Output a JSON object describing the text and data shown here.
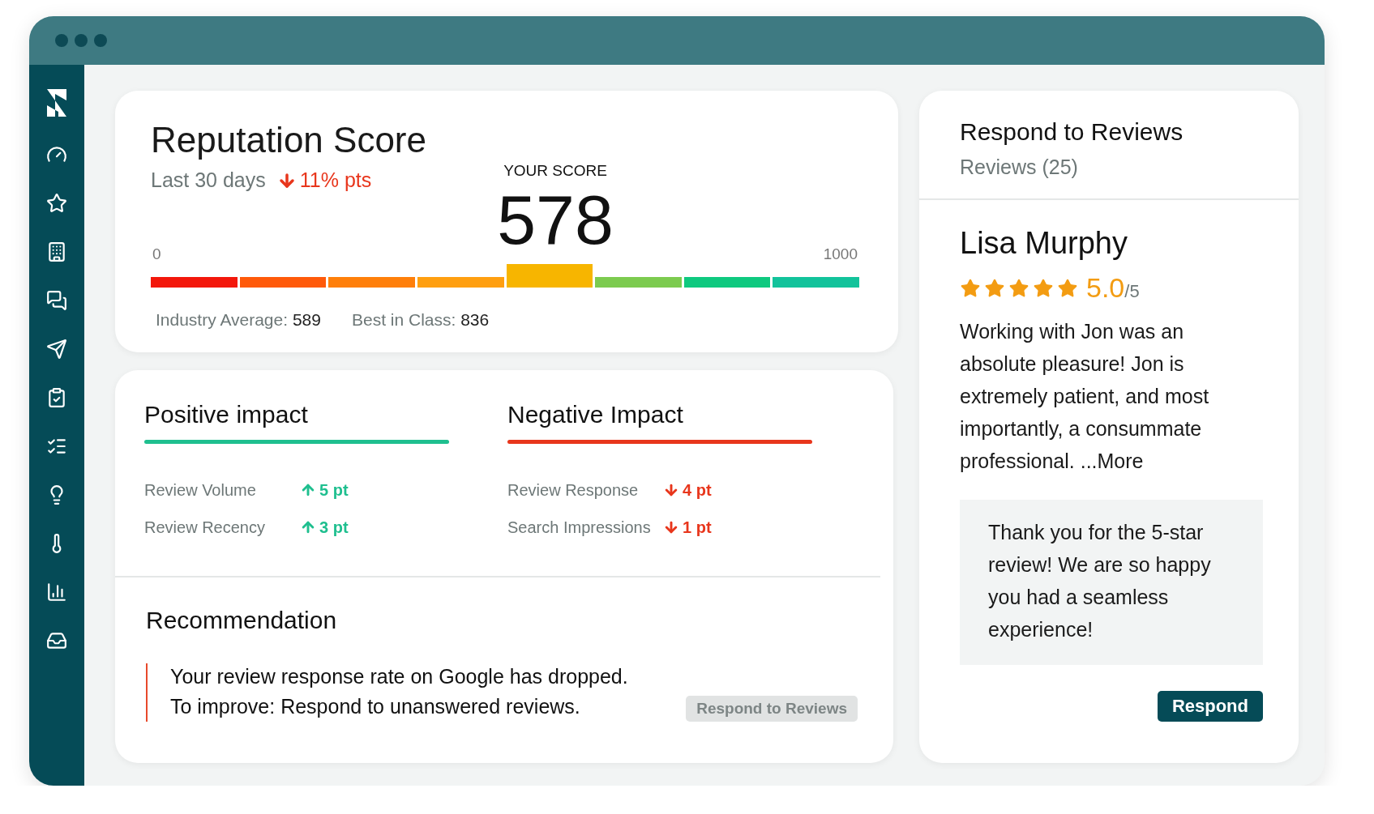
{
  "score_card": {
    "title": "Reputation Score",
    "period": "Last 30 days",
    "change": {
      "kind": "down",
      "text": "11% pts"
    },
    "score_label": "YOUR SCORE",
    "score": "578",
    "scale_min": "0",
    "scale_max": "1000",
    "segments": [
      {
        "color": "#f3170b",
        "selected": false
      },
      {
        "color": "#ff5a0a",
        "selected": false
      },
      {
        "color": "#ff7f0a",
        "selected": false
      },
      {
        "color": "#ff9f10",
        "selected": false
      },
      {
        "color": "#f7b500",
        "selected": true
      },
      {
        "color": "#7ccb4f",
        "selected": false
      },
      {
        "color": "#0ec97f",
        "selected": false
      },
      {
        "color": "#12c39b",
        "selected": false
      }
    ],
    "benchmarks": [
      {
        "label": "Industry Average:",
        "value": "589"
      },
      {
        "label": "Best in Class:",
        "value": "836"
      }
    ]
  },
  "impact_card": {
    "columns": [
      {
        "title": "Positive impact",
        "kind": "up",
        "rows": [
          {
            "label": "Review Volume",
            "value": "5 pt"
          },
          {
            "label": "Review Recency",
            "value": "3 pt"
          }
        ]
      },
      {
        "title": "Negative Impact",
        "kind": "down",
        "rows": [
          {
            "label": "Review Response",
            "value": "4 pt"
          },
          {
            "label": "Search Impressions",
            "value": "1 pt"
          }
        ]
      }
    ],
    "recommendation": {
      "title": "Recommendation",
      "lines": [
        "Your review response rate on Google has dropped.",
        "To improve: Respond to unanswered reviews."
      ],
      "button": {
        "label": "Respond to Reviews",
        "disabled": true
      }
    }
  },
  "reviews_card": {
    "title": "Respond to Reviews",
    "subtitle": "Reviews (25)",
    "review": {
      "author": "Lisa Murphy",
      "stars": 5,
      "rating": "5.0",
      "rating_max": "/5",
      "text": "Working with Jon was an absolute pleasure! Jon is extremely patient, and most importantly, a consummate professional. ...More",
      "reply": "Thank you for the 5-star review! We are so happy you had a seamless experience!"
    },
    "button": {
      "label": "Respond",
      "disabled": false
    }
  }
}
